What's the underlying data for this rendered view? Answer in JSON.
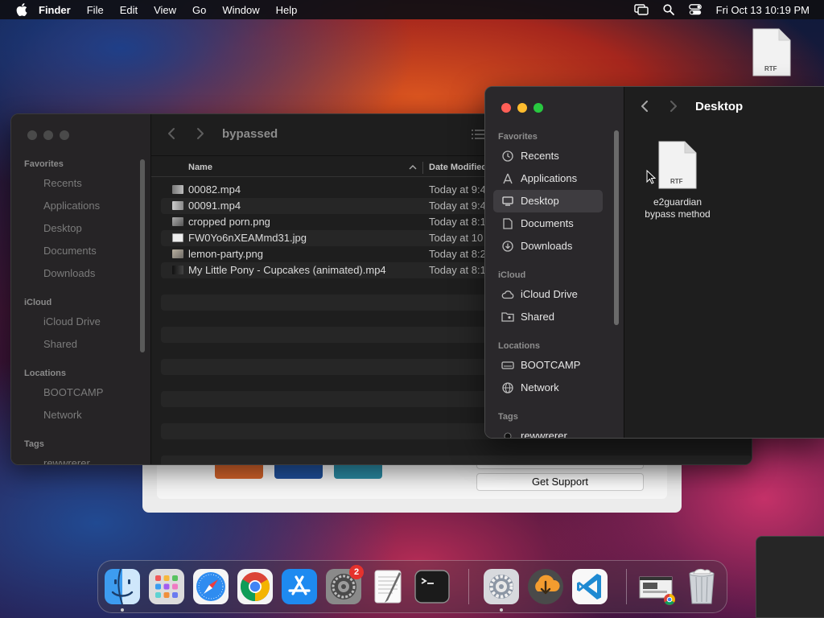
{
  "menubar": {
    "app_name": "Finder",
    "menus": [
      "File",
      "Edit",
      "View",
      "Go",
      "Window",
      "Help"
    ],
    "clock": "Fri Oct 13  10:19 PM"
  },
  "desktop_file": {
    "type_label": "RTF"
  },
  "background_window": {
    "support_button": "Get Support"
  },
  "finder_back": {
    "title": "bypassed",
    "sidebar": {
      "favorites_header": "Favorites",
      "favorites": [
        "Recents",
        "Applications",
        "Desktop",
        "Documents",
        "Downloads"
      ],
      "icloud_header": "iCloud",
      "icloud": [
        "iCloud Drive",
        "Shared"
      ],
      "locations_header": "Locations",
      "locations": [
        "BOOTCAMP",
        "Network"
      ],
      "tags_header": "Tags",
      "tags": [
        "rewwrerer"
      ]
    },
    "columns": {
      "name": "Name",
      "date": "Date Modified"
    },
    "files": [
      {
        "name": "00082.mp4",
        "date": "Today at 9:4"
      },
      {
        "name": "00091.mp4",
        "date": "Today at 9:4"
      },
      {
        "name": "cropped porn.png",
        "date": "Today at 8:1"
      },
      {
        "name": "FW0Yo6nXEAMmd31.jpg",
        "date": "Today at 10"
      },
      {
        "name": "lemon-party.png",
        "date": "Today at 8:2"
      },
      {
        "name": "My Little Pony - Cupcakes (animated).mp4",
        "date": "Today at 8:1"
      }
    ]
  },
  "finder_front": {
    "title": "Desktop",
    "sidebar": {
      "favorites_header": "Favorites",
      "favorites": [
        "Recents",
        "Applications",
        "Desktop",
        "Documents",
        "Downloads"
      ],
      "icloud_header": "iCloud",
      "icloud": [
        "iCloud Drive",
        "Shared"
      ],
      "locations_header": "Locations",
      "locations": [
        "BOOTCAMP",
        "Network"
      ],
      "tags_header": "Tags",
      "tags": [
        "rewwrerer"
      ]
    },
    "selected_sidebar_item": "Desktop",
    "file": {
      "type_label": "RTF",
      "name_line1": "e2guardian",
      "name_line2": "bypass method"
    }
  },
  "dock": {
    "apps": [
      "Finder",
      "Launchpad",
      "Safari",
      "Google Chrome",
      "App Store",
      "System Settings",
      "TextEdit",
      "Terminal",
      "System Preferences",
      "Downloader",
      "Visual Studio Code",
      "Downloads",
      "Trash"
    ],
    "settings_badge": "2"
  }
}
